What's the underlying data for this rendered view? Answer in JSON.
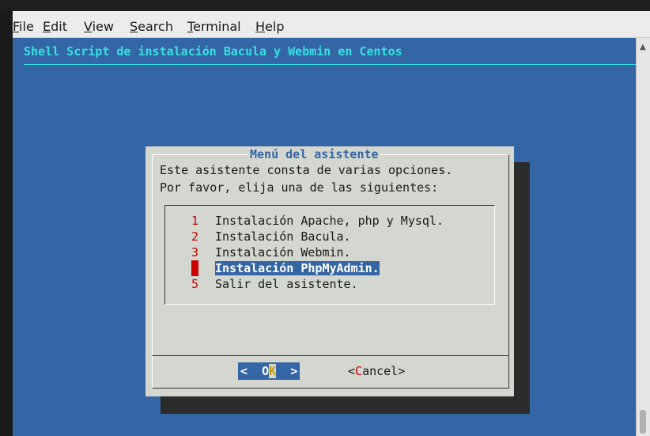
{
  "menubar": [
    {
      "label": "File",
      "accel": "F",
      "rest": "ile"
    },
    {
      "label": "Edit",
      "accel": "E",
      "rest": "dit"
    },
    {
      "label": "View",
      "accel": "V",
      "rest": "iew"
    },
    {
      "label": "Search",
      "accel": "S",
      "rest": "earch"
    },
    {
      "label": "Terminal",
      "accel": "T",
      "rest": "erminal"
    },
    {
      "label": "Help",
      "accel": "H",
      "rest": "elp"
    }
  ],
  "terminal": {
    "title": "Shell Script de instalación Bacula y Webmin en Centos"
  },
  "dialog": {
    "title": "Menú del asistente",
    "desc_line1": "Este asistente consta de varias opciones.",
    "desc_line2": "Por favor, elija una de las siguientes:",
    "items": [
      {
        "num": "1",
        "label": "Instalación Apache, php y Mysql."
      },
      {
        "num": "2",
        "label": "Instalación Bacula."
      },
      {
        "num": "3",
        "label": "Instalación Webmin."
      },
      {
        "num": "4",
        "label": "Instalación PhpMyAdmin."
      },
      {
        "num": "5",
        "label": "Salir del asistente."
      }
    ],
    "selected_index": 3,
    "ok": {
      "pre": "<  O",
      "hot": "K",
      "post": "  >"
    },
    "cancel": {
      "pre": "<",
      "hot": "C",
      "post": "ancel>"
    }
  },
  "colors": {
    "terminal_bg": "#3465a4",
    "title": "#34e2e2",
    "dialog_bg": "#d3d7cf",
    "hotkey": "#cc0000",
    "highlight": "#3465a4"
  }
}
